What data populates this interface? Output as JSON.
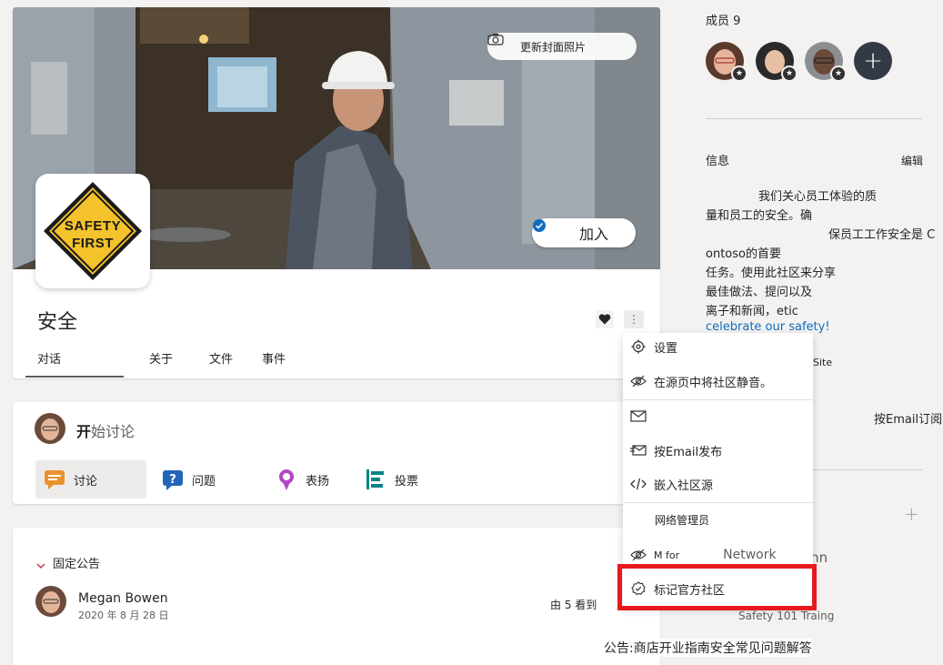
{
  "header": {
    "update_cover_label": "更新封面照片",
    "join_label": "加入",
    "logo_line1": "SAFETY",
    "logo_line2": "FIRST",
    "community_title": "安全",
    "tabs": [
      {
        "label": "对话"
      },
      {
        "label": "关于"
      },
      {
        "label": "文件"
      },
      {
        "label": "事件"
      }
    ],
    "more_label": "⋮"
  },
  "composer": {
    "start_prefix": "开",
    "start_rest": "始讨论",
    "post_types": [
      {
        "label": "讨论",
        "icon": "discussion-icon",
        "color": "#e8912d"
      },
      {
        "label": "问题",
        "icon": "question-icon",
        "color": "#2266b8"
      },
      {
        "label": "表扬",
        "icon": "praise-icon",
        "color": "#b146c2"
      },
      {
        "label": "投票",
        "icon": "poll-icon",
        "color": "#038387"
      }
    ]
  },
  "pinned": {
    "title": "固定公告",
    "author": "Megan Bowen",
    "date": "2020 年 8 月 28 日",
    "seen_by": "由 5 看到"
  },
  "sidebar": {
    "members_label": "成员 9",
    "add_member_label": "+",
    "info_label": "信息",
    "edit_label": "编辑",
    "info_lines": [
      "我们关心员工体验的质",
      "量和员工的安全。确",
      "保员工工作安全是 C",
      "ontoso的首要",
      "任务。使用此社区来分享",
      "最佳做法、提问以及",
      "离子和新闻，etic",
      "celebrate our safety!"
    ],
    "site_label": "Site",
    "subscribe_email": "按Email订阅",
    "plus_label": "+",
    "bg_inn": "inn",
    "bg_training": "Safety 101 Traing",
    "announcement": "公告:商店开业指南安全常见问题解答"
  },
  "menu": {
    "items": [
      {
        "label": "设置",
        "icon": "gear-icon"
      },
      {
        "label": "在源页中将社区静音。",
        "icon": "mute-eye-icon"
      },
      {
        "label": "",
        "icon": "mail-icon"
      },
      {
        "label": "按Email发布",
        "icon": "email-post-icon"
      },
      {
        "label": "嵌入社区源",
        "icon": "embed-code-icon"
      },
      {
        "label": "网络管理员",
        "icon": ""
      },
      {
        "label_a": "M for",
        "label_b": "Network",
        "icon": "mute-eye-icon"
      },
      {
        "label": "标记官方社区",
        "icon": "verified-badge-icon"
      }
    ]
  },
  "colors": {
    "accent": "#0f6cbd",
    "highlight": "#e5191f",
    "add_member_bg": "#323a45"
  }
}
